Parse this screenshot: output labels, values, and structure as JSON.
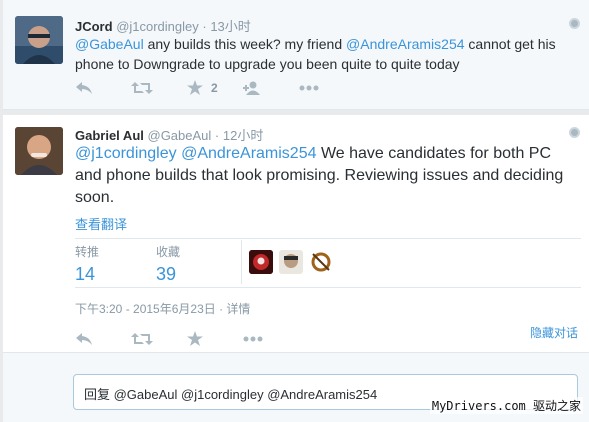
{
  "tweet1": {
    "name": "JCord",
    "handle": "@j1cordingley",
    "time": "· 13小时",
    "mention1": "@GabeAul",
    "text1": "  any builds this week? my friend ",
    "mention2": "@AndreAramis254",
    "text2": " cannot get his phone to Downgrade to upgrade you been quite to quite today",
    "favorite_count": "2"
  },
  "tweet2": {
    "name": "Gabriel Aul",
    "handle": "@GabeAul",
    "time": "· 12小时",
    "mention1": "@j1cordingley",
    "mention2": "@AndreAramis254",
    "text": " We have candidates for both PC and phone builds that look promising. Reviewing issues and deciding soon.",
    "translate_label": "查看翻译",
    "retweets_label": "转推",
    "retweets_count": "14",
    "favorites_label": "收藏",
    "favorites_count": "39",
    "timestamp": "下午3:20 - 2015年6月23日 · 详情",
    "hide_conversation": "隐藏对话"
  },
  "reply": {
    "text": "回复 @GabeAul @j1cordingley @AndreAramis254"
  },
  "watermark": "MyDrivers.com 驱动之家",
  "colors": {
    "link": "#3b94d9",
    "muted": "#8899a6",
    "icon": "#aab8c2"
  },
  "icons": [
    "reply-icon",
    "retweet-icon",
    "star-icon",
    "follow-icon",
    "more-icon",
    "globe-icon"
  ]
}
